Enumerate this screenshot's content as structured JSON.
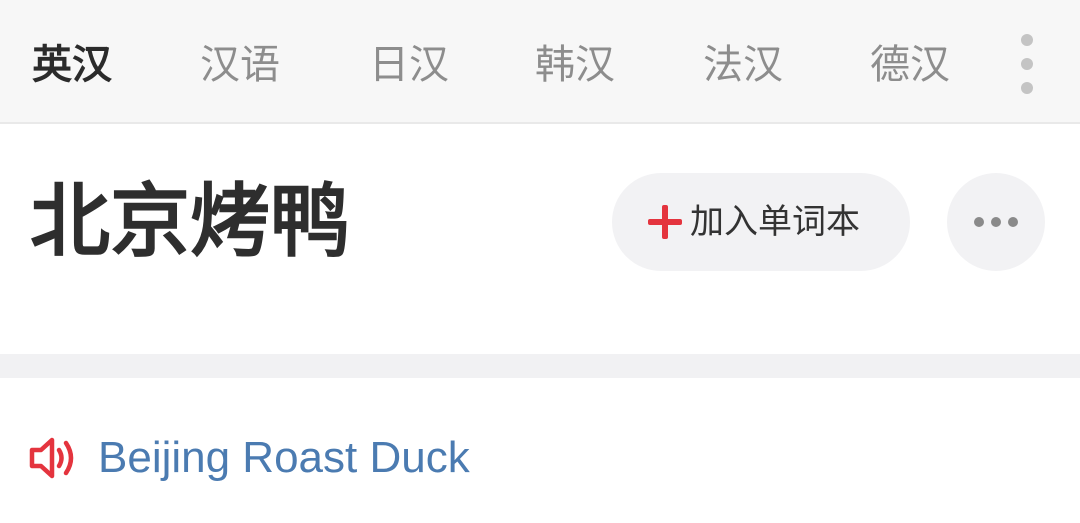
{
  "tabs": [
    {
      "label": "英汉",
      "active": true
    },
    {
      "label": "汉语",
      "active": false
    },
    {
      "label": "日汉",
      "active": false
    },
    {
      "label": "韩汉",
      "active": false
    },
    {
      "label": "法汉",
      "active": false
    },
    {
      "label": "德汉",
      "active": false
    }
  ],
  "entry": {
    "headword": "北京烤鸭",
    "add_label": "加入单词本",
    "translation": "Beijing Roast Duck"
  },
  "icons": {
    "overflow_menu": "kebab-menu-icon",
    "add": "plus-icon",
    "more": "ellipsis-icon",
    "audio": "speaker-icon"
  },
  "colors": {
    "accent_red": "#e4343e",
    "link_blue": "#4b7bb1",
    "active_tab": "#2b2b2b",
    "inactive_tab": "#8d8d8d"
  }
}
